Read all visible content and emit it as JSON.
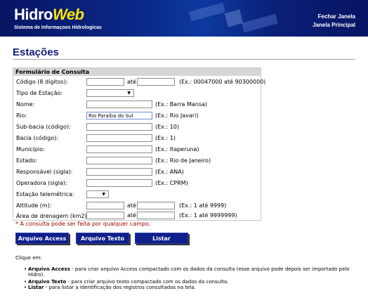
{
  "header": {
    "logo_hidro": "Hidro",
    "logo_web": "Web",
    "subtitle": "Sistema de Informaçoes Hidrologicas",
    "link_close": "Fechar Janela",
    "link_main": "Janela Principal"
  },
  "page_title": "Estações",
  "form": {
    "heading": "Formulário de Consulta",
    "ate": "até",
    "rows": [
      {
        "label": "Código (8 dígitos):",
        "hint": "(Ex.: 00047000 até 90300000)"
      },
      {
        "label": "Tipo de Estação:"
      },
      {
        "label": "Nome:",
        "hint": "(Ex.: Barra Mansa)"
      },
      {
        "label": "Rio:",
        "value": "Rio Paraíba do Sul",
        "hint": "(Ex.: Rio Javari)"
      },
      {
        "label": "Sub-bacia (código):",
        "hint": "(Ex.: 10)"
      },
      {
        "label": "Bacia (código):",
        "hint": "(Ex.: 1)"
      },
      {
        "label": "Município:",
        "hint": "(Ex.: Itaperuna)"
      },
      {
        "label": "Estado:",
        "hint": "(Ex.: Rio de Janeiro)"
      },
      {
        "label": "Responsável (sigla):",
        "hint": "(Ex.: ANA)"
      },
      {
        "label": "Operadora (sigla):",
        "hint": "(Ex.: CPRM)"
      },
      {
        "label": "Estação telemétrica:"
      },
      {
        "label": "Altitude (m):",
        "hint": "(Ex.: 1 até 9999)"
      },
      {
        "label": "Área de drenagem (km2):",
        "hint": "(Ex.: 1 até 9999999)"
      }
    ]
  },
  "note": "* A consulta pode ser feita por qualquer campo.",
  "buttons": {
    "access": "Arquivo Access",
    "texto": "Arquivo Texto",
    "listar": "Listar"
  },
  "help": {
    "intro": "Clique em:",
    "items": [
      {
        "term": "Arquivo Access",
        "text": " - para criar arquivo Access compactado com os dados da consulta (esse arquivo pode depois ser importado pelo Hidro)."
      },
      {
        "term": "Arquivo Texto",
        "text": " - para criar arquivo texto compactado com os dados da consulta."
      },
      {
        "term": "Listar",
        "text": " - para listar a identificação dos registros consultados na tela."
      }
    ]
  },
  "colors": {
    "header_bg": "#0a1a6e",
    "logo_accent": "#ffe600",
    "title": "#12207a",
    "button_bg": "#0f1f8c",
    "note": "#a00000"
  }
}
